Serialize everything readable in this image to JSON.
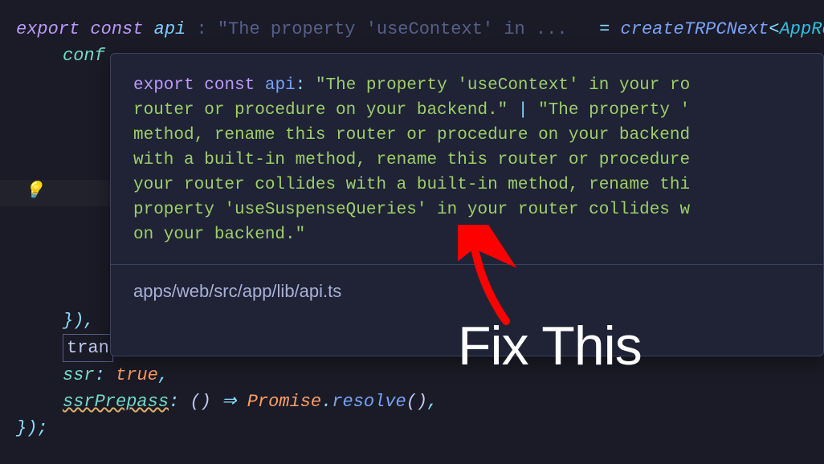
{
  "code": {
    "line1": {
      "export": "export",
      "const": "const",
      "var": "api",
      "hint_colon": ": ",
      "hint": "\"The property 'useContext' in ...",
      "eq": "=",
      "fn": "createTRPCNext",
      "lt": "<",
      "type": "AppRouter"
    },
    "line2": {
      "prop": "conf"
    },
    "line4": {
      "close": "}),"
    },
    "line5": {
      "tran": "tran"
    },
    "line6": {
      "prop": "ssr",
      "val": "true"
    },
    "line7": {
      "prop": "ssrPrepass",
      "cls": "Promise",
      "method": "resolve"
    },
    "line8": {
      "close": "});"
    }
  },
  "tooltip": {
    "sig": {
      "export": "export",
      "const": "const",
      "var": "api",
      "colon": ":",
      "str1": "\"The property 'useContext' in your ro",
      "str2_pre": "router or procedure on your backend.\"",
      "pipe": " | ",
      "str2_post": "\"The property '",
      "str3": "method, rename this router or procedure on your backend",
      "str4": "with a built-in method, rename this router or procedure",
      "str5": "your router collides with a built-in method, rename thi",
      "str6": "property 'useSuspenseQueries' in your router collides w",
      "str7": "on your backend.\""
    },
    "path": "apps/web/src/app/lib/api.ts"
  },
  "annotation": {
    "text": "Fix This"
  },
  "icons": {
    "bulb": "lightbulb-icon"
  }
}
